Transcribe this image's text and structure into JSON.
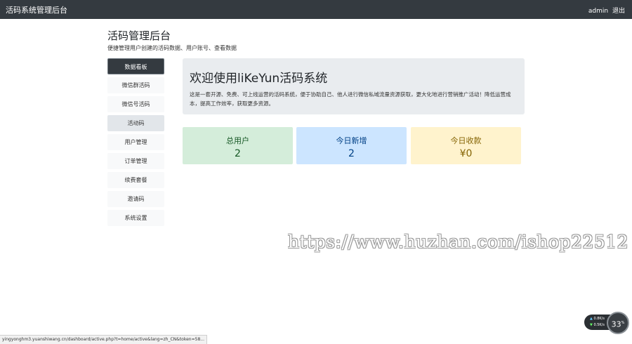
{
  "topbar": {
    "brand": "活码系统管理后台",
    "username": "admin",
    "logout": "退出"
  },
  "header": {
    "title": "活码管理后台",
    "subtitle": "便捷管理用户创建的活码数据、用户账号、查看数据"
  },
  "sidebar": {
    "items": [
      {
        "label": "数据看板"
      },
      {
        "label": "微信群活码"
      },
      {
        "label": "微信号活码"
      },
      {
        "label": "活动码"
      },
      {
        "label": "用户管理"
      },
      {
        "label": "订单管理"
      },
      {
        "label": "续费套餐"
      },
      {
        "label": "邀请码"
      },
      {
        "label": "系统设置"
      }
    ]
  },
  "welcome": {
    "title": "欢迎使用liKeYun活码系统",
    "text": "这是一套开源、免费、可上线运营的活码系统，便于协助自己、他人进行微信私域流量资源获取，更大化地进行营销推广活动！降低运营成本，提高工作效率，获取更多资源。"
  },
  "stats": [
    {
      "label": "总用户",
      "value": "2"
    },
    {
      "label": "今日新增",
      "value": "2"
    },
    {
      "label": "今日收款",
      "value": "¥0"
    }
  ],
  "watermark": "https://www.huzhan.com/ishop22512",
  "status_url": "yingyonghm3.yuanshiwang.cn/dashboard/active.php?t=home/active&lang=zh_CN&token=58...",
  "net_widget": {
    "up": "0.8K/s",
    "down": "0.5K/s",
    "percent": "33",
    "percent_unit": "%"
  }
}
